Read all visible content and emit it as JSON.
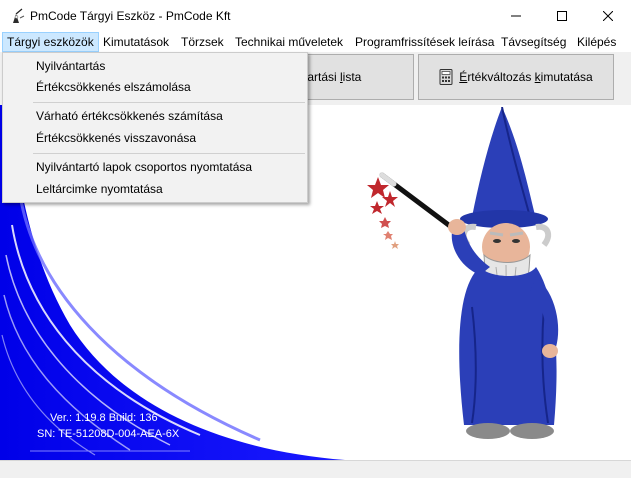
{
  "window": {
    "title": "PmCode Tárgyi Eszköz - PmCode Kft"
  },
  "menubar": {
    "items": [
      {
        "label": "Tárgyi eszközök"
      },
      {
        "label": "Kimutatások"
      },
      {
        "label": "Törzsek"
      },
      {
        "label": "Technikai műveletek"
      },
      {
        "label": "Programfrissítések leírása"
      },
      {
        "label": "Távsegítség"
      },
      {
        "label": "Kilépés"
      }
    ]
  },
  "dropdown": {
    "items": [
      {
        "label": "Nyilvántartás"
      },
      {
        "label": "Értékcsökkenés elszámolása"
      },
      {
        "label": "Várható értékcsökkenés számítása"
      },
      {
        "label": "Értékcsökkenés visszavonása"
      },
      {
        "label": "Nyilvántartó lapok csoportos nyomtatása"
      },
      {
        "label": "Leltárcimke nyomtatása"
      }
    ]
  },
  "toolbar": {
    "inventory_list_prefix": "ántartási ",
    "inventory_list_underlined": "l",
    "inventory_list_suffix": "ista",
    "value_change_underlined_1": "É",
    "value_change_mid": "rtékváltozás ",
    "value_change_underlined_2": "k",
    "value_change_suffix": "imutatása"
  },
  "footer_info": {
    "version": "Ver.: 1.19.8  Build: 136",
    "serial": "SN: TE-51208D-004-AEA-6X"
  },
  "colors": {
    "menu_highlight": "#cce8ff",
    "wave_blue": "#0000ff",
    "wizard_robe": "#2b3fb8"
  }
}
